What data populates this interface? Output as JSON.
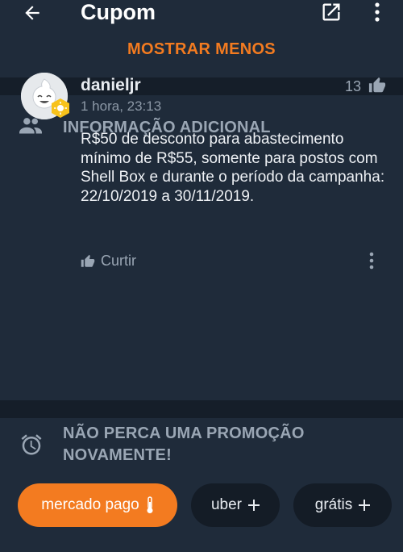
{
  "appbar": {
    "title": "Cupom",
    "back_icon": "arrow-left-icon",
    "open_icon": "open-in-new-icon",
    "more_icon": "more-vertical-icon"
  },
  "details": {
    "show_less_label": "MOSTRAR MENOS"
  },
  "additional_info": {
    "section_title": "INFORMAÇÃO ADICIONAL",
    "section_icon": "people-icon",
    "comment": {
      "username": "danieljr",
      "time": "1 hora, 23:13",
      "likes": "13",
      "text": "R$50 de desconto para abastecimento mínimo de R$55, somente para postos com Shell Box e durante o período da campanha: 22/10/2019 a 30/11/2019.",
      "like_label": "Curtir"
    }
  },
  "alerts": {
    "icon": "alarm-icon",
    "text": "NÃO PERCA UMA PROMOÇÃO NOVAMENTE!",
    "chips": [
      {
        "label": "mercado pago",
        "icon": "thermometer-icon",
        "active": true
      },
      {
        "label": "uber",
        "icon": "plus-icon",
        "active": false
      },
      {
        "label": "grátis",
        "icon": "plus-icon",
        "active": false
      }
    ]
  },
  "colors": {
    "background": "#151e29",
    "card": "#1f2b3a",
    "accent": "#f37b20",
    "muted_text": "#9aa6b4"
  }
}
